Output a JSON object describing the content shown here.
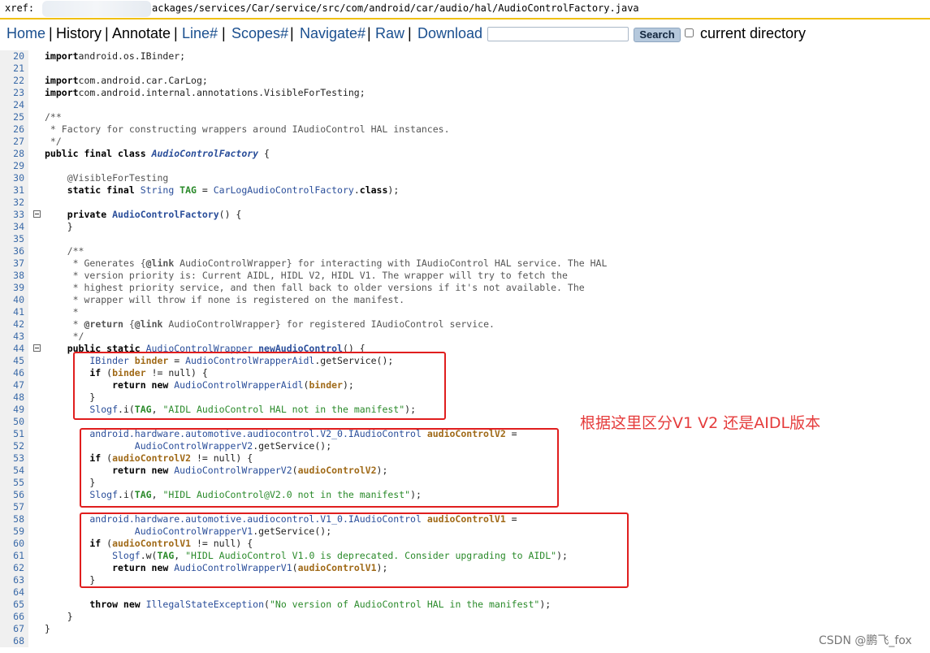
{
  "header": {
    "xref_label": "xref:",
    "path": "ackages/services/Car/service/src/com/android/car/audio/hal/AudioControlFactory.java"
  },
  "nav": {
    "items": [
      "Home",
      "History",
      "Annotate",
      "Line#",
      "Scopes#",
      "Navigate#",
      "Raw",
      "Download"
    ],
    "separator": "|",
    "search_placeholder": "",
    "search_button": "Search",
    "current_directory_label": "current directory"
  },
  "colors": {
    "highlight": "#e01e1e",
    "annotation": "#e53c3c",
    "link": "#1a4f8f",
    "xref_bar": "#f0c010"
  },
  "code": {
    "lines": [
      {
        "n": "20",
        "fold": false,
        "segs": [
          [
            "k",
            "import"
          ],
          [
            "",
            "android.os.IBinder;"
          ]
        ]
      },
      {
        "n": "21",
        "fold": false,
        "segs": []
      },
      {
        "n": "22",
        "fold": false,
        "segs": [
          [
            "k",
            "import"
          ],
          [
            "",
            "com.android.car.CarLog;"
          ]
        ]
      },
      {
        "n": "23",
        "fold": false,
        "segs": [
          [
            "k",
            "import"
          ],
          [
            "",
            "com.android.internal.annotations.VisibleForTesting;"
          ]
        ]
      },
      {
        "n": "24",
        "fold": false,
        "segs": []
      },
      {
        "n": "25",
        "fold": false,
        "segs": [
          [
            "com",
            "/**"
          ]
        ]
      },
      {
        "n": "26",
        "fold": false,
        "segs": [
          [
            "com",
            " * Factory for constructing wrappers around IAudioControl HAL instances."
          ]
        ]
      },
      {
        "n": "27",
        "fold": false,
        "segs": [
          [
            "com",
            " */"
          ]
        ]
      },
      {
        "n": "28",
        "fold": false,
        "segs": [
          [
            "k",
            "public final class "
          ],
          [
            "ital",
            "AudioControlFactory"
          ],
          [
            "",
            " {"
          ]
        ]
      },
      {
        "n": "29",
        "fold": false,
        "segs": []
      },
      {
        "n": "30",
        "fold": false,
        "segs": [
          [
            "ann",
            "    @VisibleForTesting"
          ]
        ]
      },
      {
        "n": "31",
        "fold": false,
        "segs": [
          [
            "k",
            "    static final "
          ],
          [
            "cls",
            "String "
          ],
          [
            "const",
            "TAG"
          ],
          [
            "",
            " = "
          ],
          [
            "cls",
            "CarLog"
          ],
          [
            ".tagFor("
          ],
          [
            "cls",
            "AudioControlFactory"
          ],
          [
            "",
            "."
          ],
          [
            "k",
            "class"
          ],
          [
            "",
            ");"
          ]
        ]
      },
      {
        "n": "32",
        "fold": false,
        "segs": []
      },
      {
        "n": "33",
        "fold": true,
        "segs": [
          [
            "k",
            "    private "
          ],
          [
            "def",
            "AudioControlFactory"
          ],
          [
            "",
            "() {"
          ]
        ]
      },
      {
        "n": "34",
        "fold": false,
        "segs": [
          [
            "",
            "    }"
          ]
        ]
      },
      {
        "n": "35",
        "fold": false,
        "segs": []
      },
      {
        "n": "36",
        "fold": false,
        "segs": [
          [
            "com",
            "    /**"
          ]
        ]
      },
      {
        "n": "37",
        "fold": false,
        "segs": [
          [
            "com",
            "     * Generates {"
          ],
          [
            "tag",
            "@link"
          ],
          [
            "com",
            " AudioControlWrapper} for interacting with IAudioControl HAL service. The HAL"
          ]
        ]
      },
      {
        "n": "38",
        "fold": false,
        "segs": [
          [
            "com",
            "     * version priority is: Current AIDL, HIDL V2, HIDL V1. The wrapper will try to fetch the"
          ]
        ]
      },
      {
        "n": "39",
        "fold": false,
        "segs": [
          [
            "com",
            "     * highest priority service, and then fall back to older versions if it's not available. The"
          ]
        ]
      },
      {
        "n": "40",
        "fold": false,
        "segs": [
          [
            "com",
            "     * wrapper will throw if none is registered on the manifest."
          ]
        ]
      },
      {
        "n": "41",
        "fold": false,
        "segs": [
          [
            "com",
            "     *"
          ]
        ]
      },
      {
        "n": "42",
        "fold": false,
        "segs": [
          [
            "com",
            "     * "
          ],
          [
            "tag",
            "@return"
          ],
          [
            "com",
            " {"
          ],
          [
            "tag",
            "@link"
          ],
          [
            "com",
            " AudioControlWrapper} for registered IAudioControl service."
          ]
        ]
      },
      {
        "n": "43",
        "fold": false,
        "segs": [
          [
            "com",
            "     */"
          ]
        ]
      },
      {
        "n": "44",
        "fold": true,
        "segs": [
          [
            "k",
            "    public static "
          ],
          [
            "cls",
            "AudioControlWrapper "
          ],
          [
            "defu",
            "newAudioControl"
          ],
          [
            "",
            "() {"
          ]
        ]
      },
      {
        "n": "45",
        "fold": false,
        "segs": [
          [
            "cls",
            "        IBinder "
          ],
          [
            "var",
            "binder"
          ],
          [
            "",
            " = "
          ],
          [
            "cls",
            "AudioControlWrapperAidl"
          ],
          [
            "",
            ".getService();"
          ]
        ]
      },
      {
        "n": "46",
        "fold": false,
        "segs": [
          [
            "k",
            "        if"
          ],
          [
            "",
            " ("
          ],
          [
            "var",
            "binder"
          ],
          [
            "",
            " != null) {"
          ]
        ]
      },
      {
        "n": "47",
        "fold": false,
        "segs": [
          [
            "k",
            "            return new "
          ],
          [
            "cls",
            "AudioControlWrapperAidl"
          ],
          [
            "",
            "("
          ],
          [
            "var",
            "binder"
          ],
          [
            "",
            ");"
          ]
        ]
      },
      {
        "n": "48",
        "fold": false,
        "segs": [
          [
            "",
            "        }"
          ]
        ]
      },
      {
        "n": "49",
        "fold": false,
        "segs": [
          [
            "cls",
            "        Slogf"
          ],
          [
            "",
            ".i("
          ],
          [
            "const",
            "TAG"
          ],
          [
            "",
            ", "
          ],
          [
            "str",
            "\"AIDL AudioControl HAL not in the manifest\""
          ],
          [
            "",
            ");"
          ]
        ]
      },
      {
        "n": "50",
        "fold": false,
        "segs": []
      },
      {
        "n": "51",
        "fold": false,
        "segs": [
          [
            "cls",
            "        android.hardware.automotive.audiocontrol.V2_0.IAudioControl "
          ],
          [
            "var",
            "audioControlV2"
          ],
          [
            "",
            " ="
          ]
        ]
      },
      {
        "n": "52",
        "fold": false,
        "segs": [
          [
            "cls",
            "                AudioControlWrapperV2"
          ],
          [
            "",
            ".getService();"
          ]
        ]
      },
      {
        "n": "53",
        "fold": false,
        "segs": [
          [
            "k",
            "        if"
          ],
          [
            "",
            " ("
          ],
          [
            "var",
            "audioControlV2"
          ],
          [
            "",
            " != null) {"
          ]
        ]
      },
      {
        "n": "54",
        "fold": false,
        "segs": [
          [
            "k",
            "            return new "
          ],
          [
            "cls",
            "AudioControlWrapperV2"
          ],
          [
            "",
            "("
          ],
          [
            "var",
            "audioControlV2"
          ],
          [
            "",
            ");"
          ]
        ]
      },
      {
        "n": "55",
        "fold": false,
        "segs": [
          [
            "",
            "        }"
          ]
        ]
      },
      {
        "n": "56",
        "fold": false,
        "segs": [
          [
            "cls",
            "        Slogf"
          ],
          [
            "",
            ".i("
          ],
          [
            "const",
            "TAG"
          ],
          [
            "",
            ", "
          ],
          [
            "str",
            "\"HIDL AudioControl@V2.0 not in the manifest\""
          ],
          [
            "",
            ");"
          ]
        ]
      },
      {
        "n": "57",
        "fold": false,
        "segs": []
      },
      {
        "n": "58",
        "fold": false,
        "segs": [
          [
            "cls",
            "        android.hardware.automotive.audiocontrol.V1_0.IAudioControl "
          ],
          [
            "var",
            "audioControlV1"
          ],
          [
            "",
            " ="
          ]
        ]
      },
      {
        "n": "59",
        "fold": false,
        "segs": [
          [
            "cls",
            "                AudioControlWrapperV1"
          ],
          [
            "",
            ".getService();"
          ]
        ]
      },
      {
        "n": "60",
        "fold": false,
        "segs": [
          [
            "k",
            "        if"
          ],
          [
            "",
            " ("
          ],
          [
            "var",
            "audioControlV1"
          ],
          [
            "",
            " != null) {"
          ]
        ]
      },
      {
        "n": "61",
        "fold": false,
        "segs": [
          [
            "cls",
            "            Slogf"
          ],
          [
            "",
            ".w("
          ],
          [
            "const",
            "TAG"
          ],
          [
            "",
            ", "
          ],
          [
            "str",
            "\"HIDL AudioControl V1.0 is deprecated. Consider upgrading to AIDL\""
          ],
          [
            "",
            ");"
          ]
        ]
      },
      {
        "n": "62",
        "fold": false,
        "segs": [
          [
            "k",
            "            return new "
          ],
          [
            "cls",
            "AudioControlWrapperV1"
          ],
          [
            "",
            "("
          ],
          [
            "var",
            "audioControlV1"
          ],
          [
            "",
            ");"
          ]
        ]
      },
      {
        "n": "63",
        "fold": false,
        "segs": [
          [
            "",
            "        }"
          ]
        ]
      },
      {
        "n": "64",
        "fold": false,
        "segs": []
      },
      {
        "n": "65",
        "fold": false,
        "segs": [
          [
            "k",
            "        throw new "
          ],
          [
            "cls",
            "IllegalStateException"
          ],
          [
            "",
            "("
          ],
          [
            "str",
            "\"No version of AudioControl HAL in the manifest\""
          ],
          [
            "",
            ");"
          ]
        ]
      },
      {
        "n": "66",
        "fold": false,
        "segs": [
          [
            "",
            "    }"
          ]
        ]
      },
      {
        "n": "67",
        "fold": false,
        "segs": [
          [
            "",
            "}"
          ]
        ]
      },
      {
        "n": "68",
        "fold": false,
        "segs": []
      }
    ]
  },
  "annotation_note": "根据这里区分V1 V2 还是AIDL版本",
  "watermark": "CSDN @鹏飞_fox"
}
